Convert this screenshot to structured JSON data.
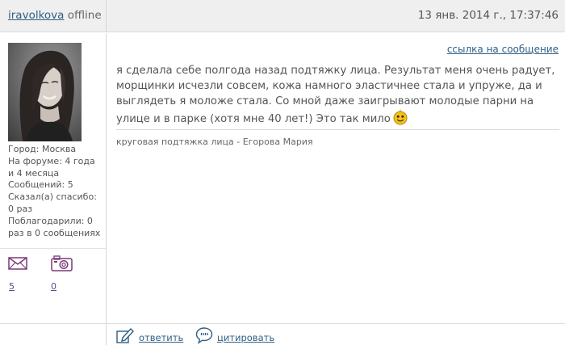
{
  "header": {
    "username": "iravolkova",
    "status": "offline",
    "date": "13 янв. 2014 г., 17:37:46"
  },
  "profile": {
    "city": "Город: Москва",
    "forum_time": "На форуме: 4 года и 4 месяца",
    "messages": "Сообщений: 5",
    "thanked": "Сказал(а) спасибо: 0 раз",
    "was_thanked": "Поблагодарили: 0 раз в 0 сообщениях",
    "mail_count": "5",
    "photo_count": "0"
  },
  "post": {
    "message_link": "ссылка на сообщение",
    "text": "я сделала себе полгода назад подтяжку лица. Результат меня очень радует, морщинки исчезли совсем, кожа намного эластичнее стала и упруже, да и выглядеть я моложе стала. Со мной даже заигрывают молодые парни на улице и в парке (хотя мне 40 лет!) Это так мило",
    "signature": "круговая подтяжка лица - Егорова Мария"
  },
  "actions": {
    "reply": "ответить",
    "quote": "цитировать"
  },
  "icons": {
    "mail": "envelope-icon",
    "photo": "camera-icon",
    "reply": "reply-pencil-icon",
    "quote": "quote-bubble-icon",
    "smiley": "smiley-emoticon"
  },
  "colors": {
    "link": "#2f5f86",
    "header_bg": "#efefef",
    "text": "#555555",
    "emoticon": "#f2c21a",
    "sidebar_icon": "#7a3a78"
  }
}
